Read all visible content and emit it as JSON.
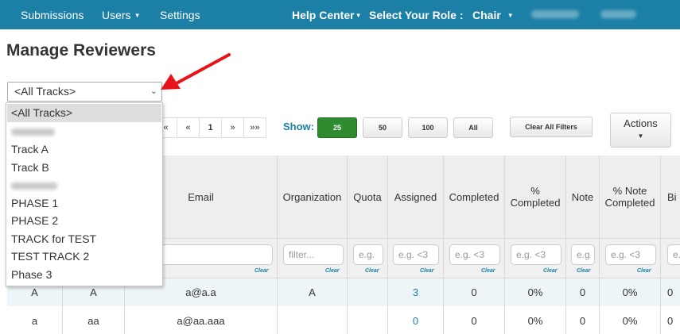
{
  "nav": {
    "submissions": "Submissions",
    "users": "Users",
    "settings": "Settings",
    "help_center": "Help Center",
    "select_role": "Select Your Role :",
    "role": "Chair"
  },
  "page_title": "Manage Reviewers",
  "track_select": {
    "value": "<All Tracks>",
    "options": [
      "<All Tracks>",
      "",
      "Track A",
      "Track B",
      "",
      "PHASE 1",
      "PHASE 2",
      "TRACK for TEST",
      "TEST TRACK 2",
      "Phase 3"
    ]
  },
  "pagination": {
    "first": "«",
    "prev": "«",
    "current": "1",
    "next": "»",
    "last": "»»"
  },
  "show": {
    "label": "Show:",
    "options": [
      "25",
      "50",
      "100",
      "All"
    ],
    "selected": "25"
  },
  "clear_all_filters": "Clear All Filters",
  "actions": "Actions",
  "table": {
    "columns": [
      "Email",
      "Organization",
      "Quota",
      "Assigned",
      "Completed",
      "% Completed",
      "Note",
      "% Note Completed",
      "Bi"
    ],
    "filters": {
      "organization": "filter...",
      "quota": "e.g.",
      "assigned": "e.g. <3",
      "completed": "e.g. <3",
      "pct_completed": "e.g. <3",
      "note": "e.g",
      "pct_note": "e.g. <3",
      "bio": "e.g",
      "clear": "Clear"
    },
    "rows": [
      {
        "c1": "A",
        "c2": "A",
        "email": "a@a.a",
        "org": "A",
        "quota": "",
        "assigned": "3",
        "completed": "0",
        "pct": "0%",
        "note": "0",
        "pct_note": "0%",
        "bio": "0"
      },
      {
        "c1": "a",
        "c2": "aa",
        "email": "a@aa.aaa",
        "org": "",
        "quota": "",
        "assigned": "0",
        "completed": "0",
        "pct": "0%",
        "note": "0",
        "pct_note": "0%",
        "bio": "0"
      }
    ]
  }
}
